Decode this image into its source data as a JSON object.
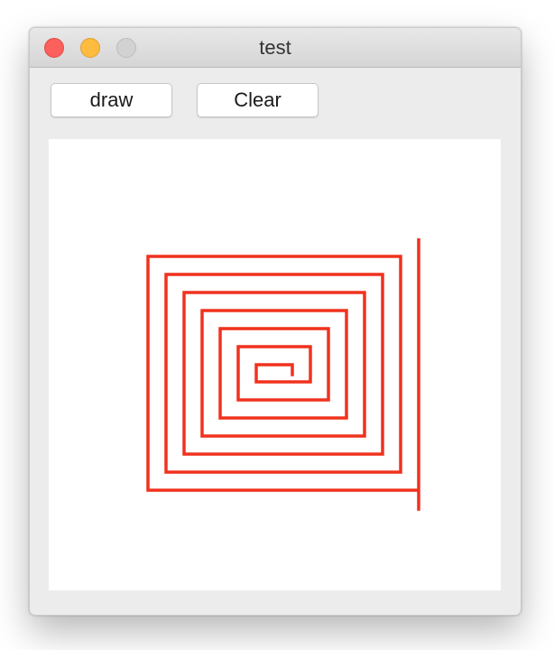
{
  "window": {
    "title": "test"
  },
  "toolbar": {
    "draw_label": "draw",
    "clear_label": "Clear"
  },
  "canvas": {
    "stroke_color": "#f0321e",
    "drawing": "square-spiral"
  }
}
